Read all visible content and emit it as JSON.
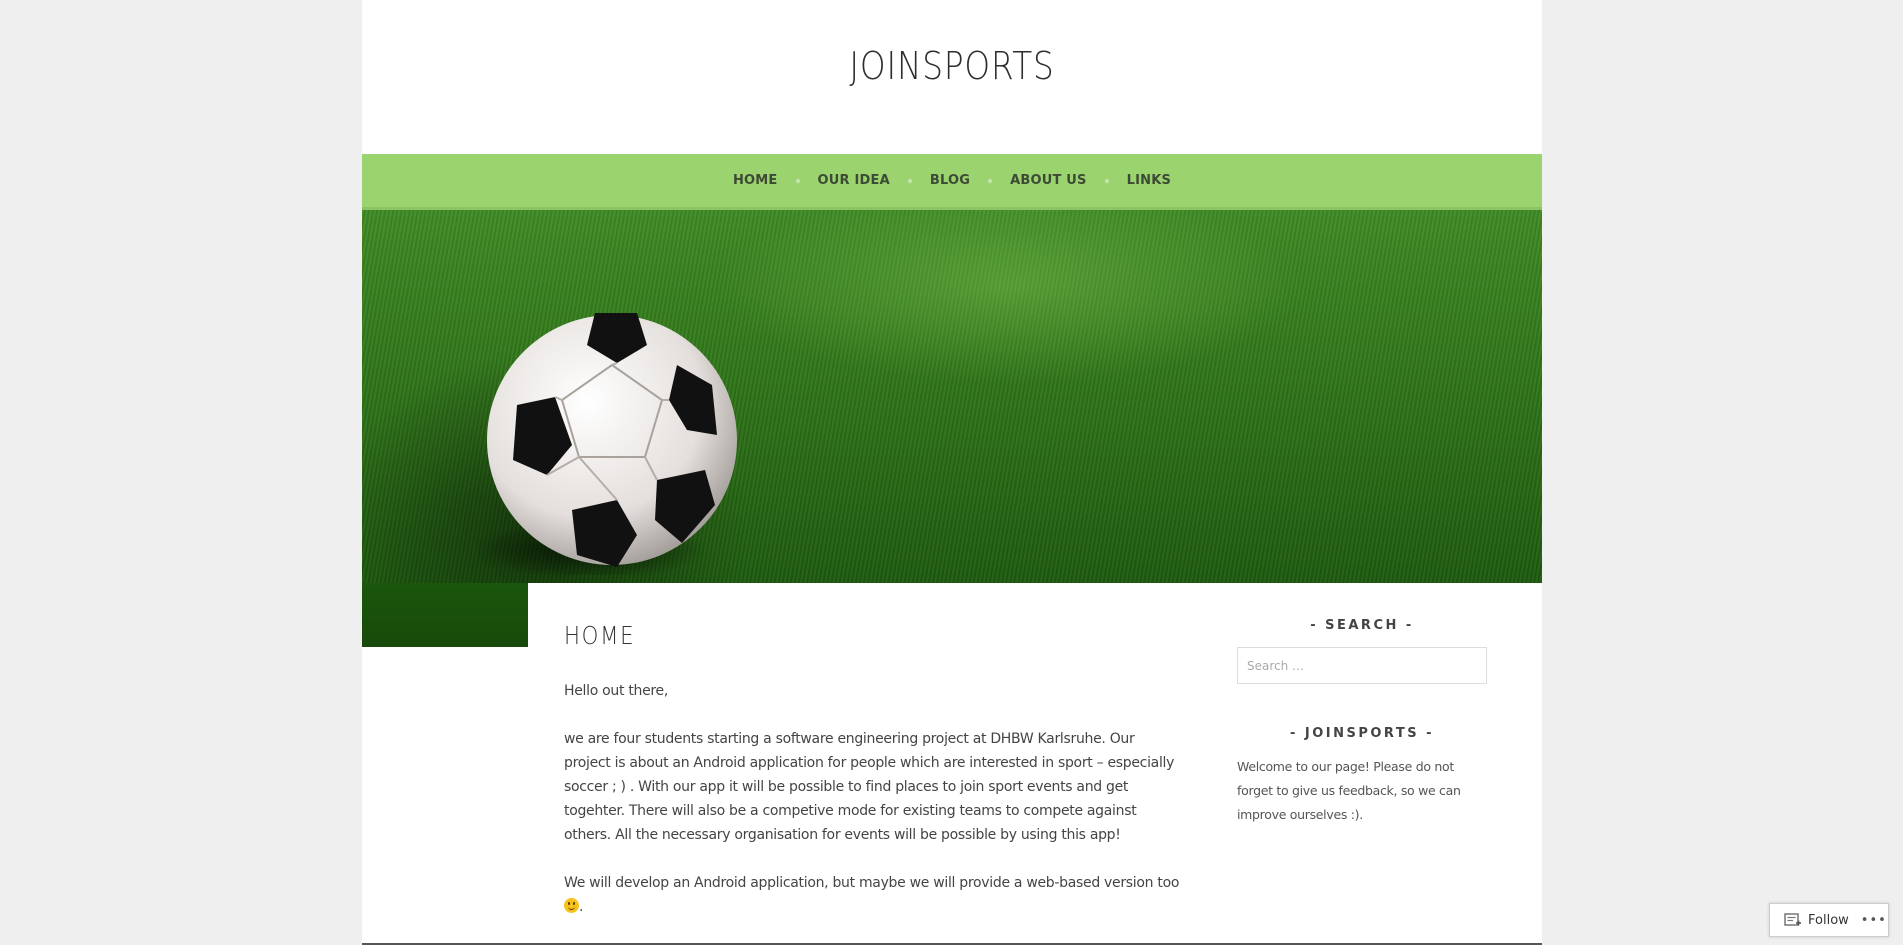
{
  "site": {
    "title": "JOINSPORTS"
  },
  "nav": {
    "items": [
      {
        "label": "HOME"
      },
      {
        "label": "OUR IDEA"
      },
      {
        "label": "BLOG"
      },
      {
        "label": "ABOUT US"
      },
      {
        "label": "LINKS"
      }
    ]
  },
  "entry": {
    "title": "HOME",
    "paragraphs": [
      "Hello out there,",
      "we are four students starting a software engineering project at DHBW Karlsruhe. Our project is about an Android application for people which are interested in sport – especially soccer ; ) . With our app it will be possible to find places to join sport events and get togehter. There will also be a competive mode for existing teams to compete against others. All the necessary organisation for events will be possible by using this app!",
      "We will develop an Android application, but maybe we will provide a web-based version too"
    ],
    "after_emoji": ".",
    "emoji": "slightly-smiling-face-icon"
  },
  "sidebar": {
    "search": {
      "title": "- SEARCH -",
      "placeholder": "Search …"
    },
    "about": {
      "title": "- JOINSPORTS -",
      "text": "Welcome to our page! Please do not forget to give us feedback, so we can improve ourselves :)."
    }
  },
  "follow": {
    "label": "Follow",
    "icon": "reader-follow-icon",
    "more": "•••"
  },
  "colors": {
    "nav_bg": "#9bd36f",
    "page_bg": "#efefef"
  }
}
